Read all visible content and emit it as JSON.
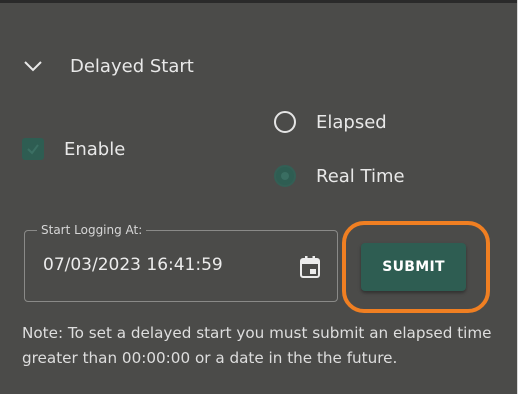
{
  "section": {
    "title": "Delayed Start",
    "chevron_icon": "chevron-down-icon"
  },
  "enable": {
    "label": "Enable",
    "checked": true
  },
  "mode": {
    "options": [
      {
        "label": "Elapsed",
        "selected": false
      },
      {
        "label": "Real Time",
        "selected": true
      }
    ]
  },
  "start_logging": {
    "label": "Start Logging At:",
    "value": "07/03/2023 16:41:59",
    "calendar_icon": "calendar-icon"
  },
  "submit": {
    "label": "SUBMIT"
  },
  "note": {
    "text": "Note: To set a delayed start you must submit an elapsed time greater than 00:00:00 or a date in the the future."
  },
  "colors": {
    "panel_bg": "#4b4b49",
    "accent": "#2e5d52",
    "highlight": "#f07f22",
    "text": "#e8e8e8"
  }
}
